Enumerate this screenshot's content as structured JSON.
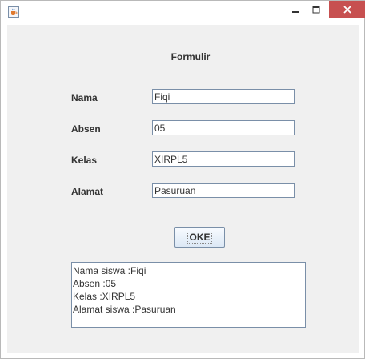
{
  "window": {
    "title": "",
    "icon": "java-coffee-icon",
    "controls": [
      "minimize-icon",
      "maximize-icon",
      "close-icon"
    ]
  },
  "form": {
    "title": "Formulir",
    "fields": [
      {
        "label": "Nama",
        "value": "Fiqi"
      },
      {
        "label": "Absen",
        "value": "05"
      },
      {
        "label": "Kelas",
        "value": "XIRPL5"
      },
      {
        "label": "Alamat",
        "value": "Pasuruan"
      }
    ],
    "submit_label": "OKE"
  },
  "output": {
    "lines": [
      "Nama siswa :Fiqi",
      "Absen :05",
      "Kelas :XIRPL5",
      "Alamat siswa :Pasuruan"
    ]
  },
  "colors": {
    "close_button": "#c75050",
    "client_background": "#f0f0f0",
    "field_border": "#7a8fa8"
  }
}
